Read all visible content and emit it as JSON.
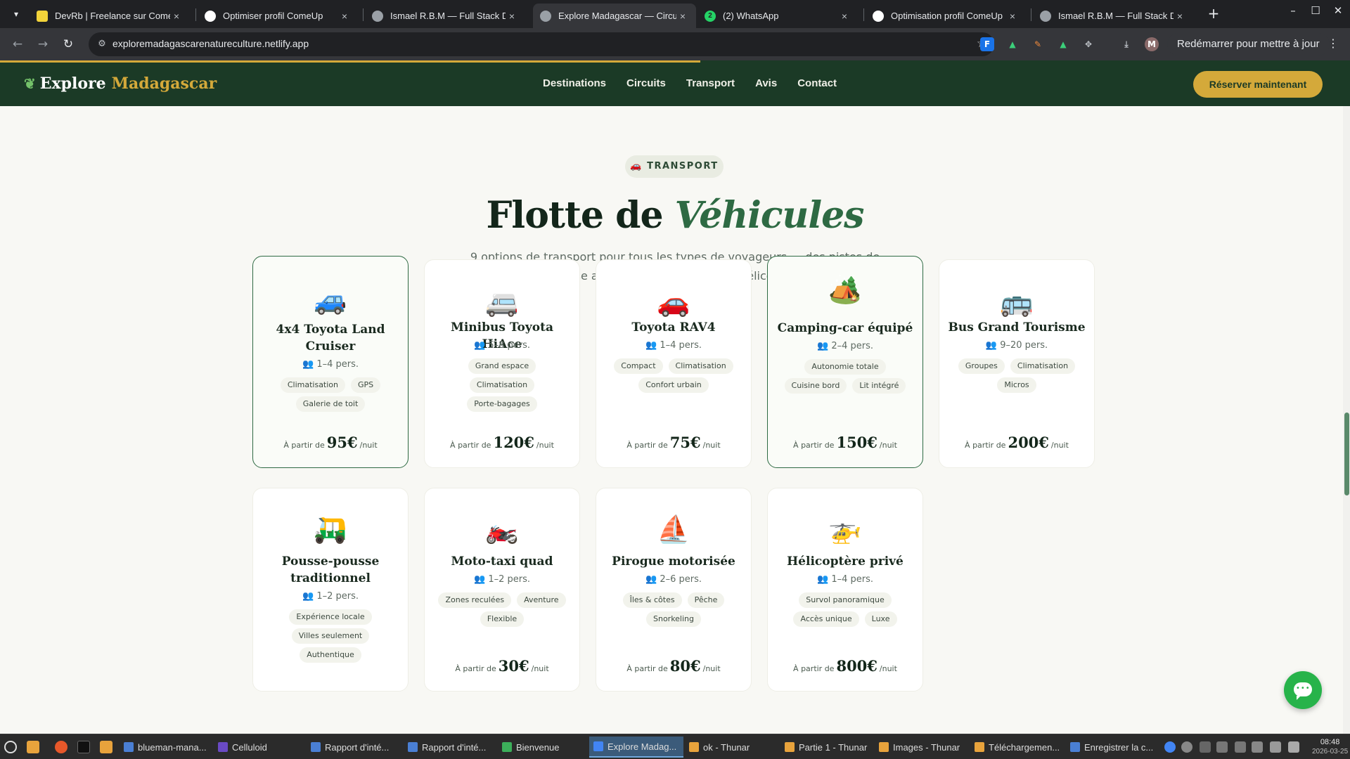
{
  "browser": {
    "tabs": [
      {
        "title": "DevRb | Freelance sur ComeUp",
        "close": "×"
      },
      {
        "title": "Optimiser profil ComeUp",
        "close": "×"
      },
      {
        "title": "Ismael R.B.M — Full Stack De",
        "close": "×"
      },
      {
        "title": "Explore Madagascar — Circu",
        "close": "×"
      },
      {
        "title": "(2) WhatsApp",
        "close": "×"
      },
      {
        "title": "Optimisation profil ComeUp",
        "close": "×"
      },
      {
        "title": "Ismael R.B.M — Full Stack De",
        "close": "×"
      }
    ],
    "whatsapp_badge": "2",
    "url": "exploremadagascarenatureculture.netlify.app",
    "restart_label": "Redémarrer pour mettre à jour",
    "profile_initial": "M",
    "new_tab": "+"
  },
  "site": {
    "logo_main": "Explore",
    "logo_accent": "Madagascar",
    "nav": [
      "Destinations",
      "Circuits",
      "Transport",
      "Avis",
      "Contact"
    ],
    "cta": "Réserver maintenant"
  },
  "section": {
    "badge_icon": "🚗",
    "badge": "TRANSPORT",
    "title_main": "Flotte de",
    "title_em": "Véhicules",
    "subtitle": "9 options de transport pour tous les types de voyageurs — des pistes de brousse aux transferts luxueux en hélicoptère.",
    "capacity_icon": "👥",
    "price_prefix": "À partir de",
    "price_suffix": "/nuit"
  },
  "vehicles": [
    {
      "emoji": "🚙",
      "name": "4x4 Toyota Land Cruiser",
      "capacity": "1–4 pers.",
      "tags": [
        "Climatisation",
        "GPS",
        "Galerie de toit"
      ],
      "price": "95€"
    },
    {
      "emoji": "🚐",
      "name": "Minibus Toyota HiAce",
      "capacity": "5–8 pers.",
      "tags": [
        "Grand espace",
        "Climatisation",
        "Porte-bagages"
      ],
      "price": "120€"
    },
    {
      "emoji": "🚗",
      "name": "Toyota RAV4",
      "capacity": "1–4 pers.",
      "tags": [
        "Compact",
        "Climatisation",
        "Confort urbain"
      ],
      "price": "75€"
    },
    {
      "emoji": "🏕️",
      "name": "Camping-car équipé",
      "capacity": "2–4 pers.",
      "tags": [
        "Autonomie totale",
        "Cuisine bord",
        "Lit intégré"
      ],
      "price": "150€"
    },
    {
      "emoji": "🚌",
      "name": "Bus Grand Tourisme",
      "capacity": "9–20 pers.",
      "tags": [
        "Groupes",
        "Climatisation",
        "Micros"
      ],
      "price": "200€"
    },
    {
      "emoji": "🛺",
      "name": "Pousse-pousse traditionnel",
      "capacity": "1–2 pers.",
      "tags": [
        "Expérience locale",
        "Villes seulement",
        "Authentique"
      ],
      "price": ""
    },
    {
      "emoji": "🏍️",
      "name": "Moto-taxi quad",
      "capacity": "1–2 pers.",
      "tags": [
        "Zones reculées",
        "Aventure",
        "Flexible"
      ],
      "price": "30€"
    },
    {
      "emoji": "⛵",
      "name": "Pirogue motorisée",
      "capacity": "2–6 pers.",
      "tags": [
        "Îles & côtes",
        "Pêche",
        "Snorkeling"
      ],
      "price": "80€"
    },
    {
      "emoji": "🚁",
      "name": "Hélicoptère privé",
      "capacity": "1–4 pers.",
      "tags": [
        "Survol panoramique",
        "Accès unique",
        "Luxe"
      ],
      "price": "800€"
    }
  ],
  "taskbar": {
    "tasks": [
      "blueman-mana...",
      "Celluloid",
      "Rapport d'inté...",
      "Rapport d'inté...",
      "Bienvenue",
      "Explore Madag...",
      "ok - Thunar",
      "Partie 1 - Thunar",
      "Images - Thunar",
      "Téléchargemen...",
      "Enregistrer la c..."
    ],
    "time": "08:48",
    "date": "2026-03-25"
  },
  "colors": {
    "nav_bg": "#1b3a26",
    "gold": "#d4a93a",
    "green_accent": "#2e6a43",
    "whatsapp": "#27b34a"
  }
}
